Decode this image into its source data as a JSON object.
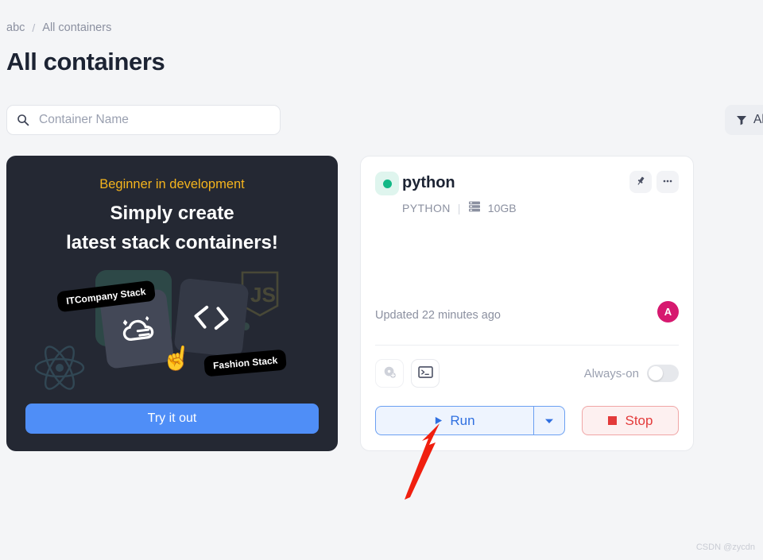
{
  "breadcrumb": {
    "root": "abc",
    "separator": "/",
    "current": "All containers"
  },
  "page": {
    "title": "All containers"
  },
  "search": {
    "placeholder": "Container Name",
    "value": "",
    "icon": "search-icon"
  },
  "filter": {
    "label": "All",
    "icon": "filter-funnel-icon"
  },
  "promo": {
    "eyebrow": "Beginner in development",
    "headline_line1": "Simply create",
    "headline_line2": "latest stack containers!",
    "cta_label": "Try it out",
    "bubble1": "ITCompany Stack",
    "bubble2": "Fashion Stack",
    "bg": "#242833",
    "accent": "#f5b41d",
    "cta_color": "#4f8ef7"
  },
  "container": {
    "name": "python",
    "status": "running",
    "status_color": "#12b886",
    "type": "PYTHON",
    "meta_separator": "|",
    "storage": "10GB",
    "storage_icon": "server-stack-icon",
    "pin_icon": "pin-icon",
    "more_icon": "more-horizontal-icon",
    "updated": "Updated 22 minutes ago",
    "avatar_initial": "A",
    "avatar_color": "#d6196f",
    "snapshot_icon": "snapshot-add-icon",
    "terminal_icon": "terminal-icon",
    "always_on_label": "Always-on",
    "always_on_state": "off",
    "run_label": "Run",
    "run_icon": "play-icon",
    "run_dropdown_icon": "chevron-down-icon",
    "run_color": "#2f6fe0",
    "stop_label": "Stop",
    "stop_icon": "stop-square-icon",
    "stop_color": "#e33a3a"
  },
  "watermark": {
    "text": "CSDN @zycdn"
  }
}
